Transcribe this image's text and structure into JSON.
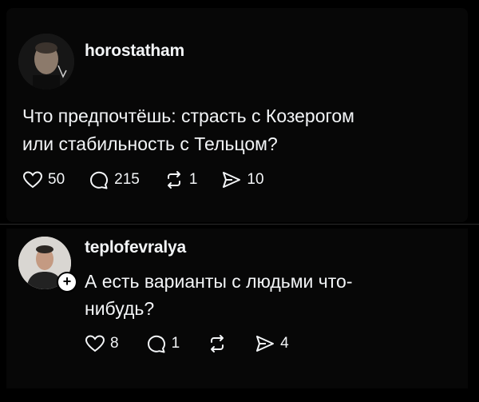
{
  "post": {
    "username": "horostatham",
    "text_line1": "Что предпочтёшь: страсть с Козерогом",
    "text_line2": "или стабильность с Тельцом?",
    "likes": "50",
    "comments": "215",
    "reposts": "1",
    "shares": "10"
  },
  "reply": {
    "username": "teplofevralya",
    "text_line1": "А есть варианты с людьми что-",
    "text_line2": "нибудь?",
    "likes": "8",
    "comments": "1",
    "shares": "4",
    "follow_symbol": "+"
  },
  "icons": {
    "like": "heart-icon",
    "comment": "comment-bubble-icon",
    "repost": "repost-icon",
    "share": "share-send-icon"
  },
  "colors": {
    "background": "#000000",
    "text": "#f3f5f7",
    "divider": "#2a2a2a"
  }
}
